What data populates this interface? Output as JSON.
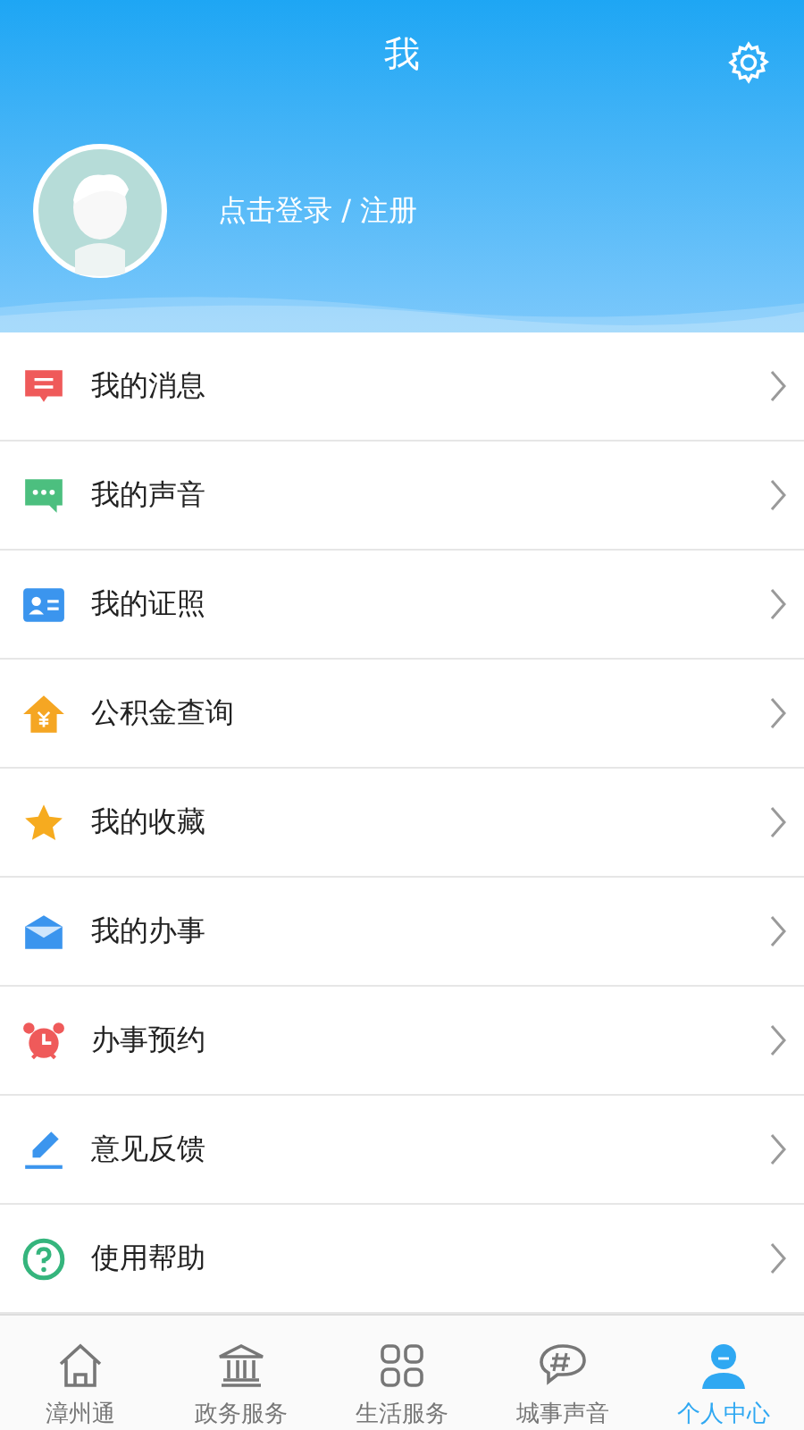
{
  "header": {
    "title": "我",
    "login": "点击登录 / 注册"
  },
  "menu": [
    {
      "label": "我的消息",
      "kind": "message"
    },
    {
      "label": "我的声音",
      "kind": "chat"
    },
    {
      "label": "我的证照",
      "kind": "card"
    },
    {
      "label": "公积金查询",
      "kind": "fund"
    },
    {
      "label": "我的收藏",
      "kind": "star"
    },
    {
      "label": "我的办事",
      "kind": "mail"
    },
    {
      "label": "办事预约",
      "kind": "alarm"
    },
    {
      "label": "意见反馈",
      "kind": "pen"
    },
    {
      "label": "使用帮助",
      "kind": "help"
    }
  ],
  "tabs": [
    {
      "label": "漳州通",
      "kind": "home",
      "selected": false
    },
    {
      "label": "政务服务",
      "kind": "gov",
      "selected": false
    },
    {
      "label": "生活服务",
      "kind": "grid",
      "selected": false
    },
    {
      "label": "城事声音",
      "kind": "topic",
      "selected": false
    },
    {
      "label": "个人中心",
      "kind": "person",
      "selected": true
    }
  ]
}
